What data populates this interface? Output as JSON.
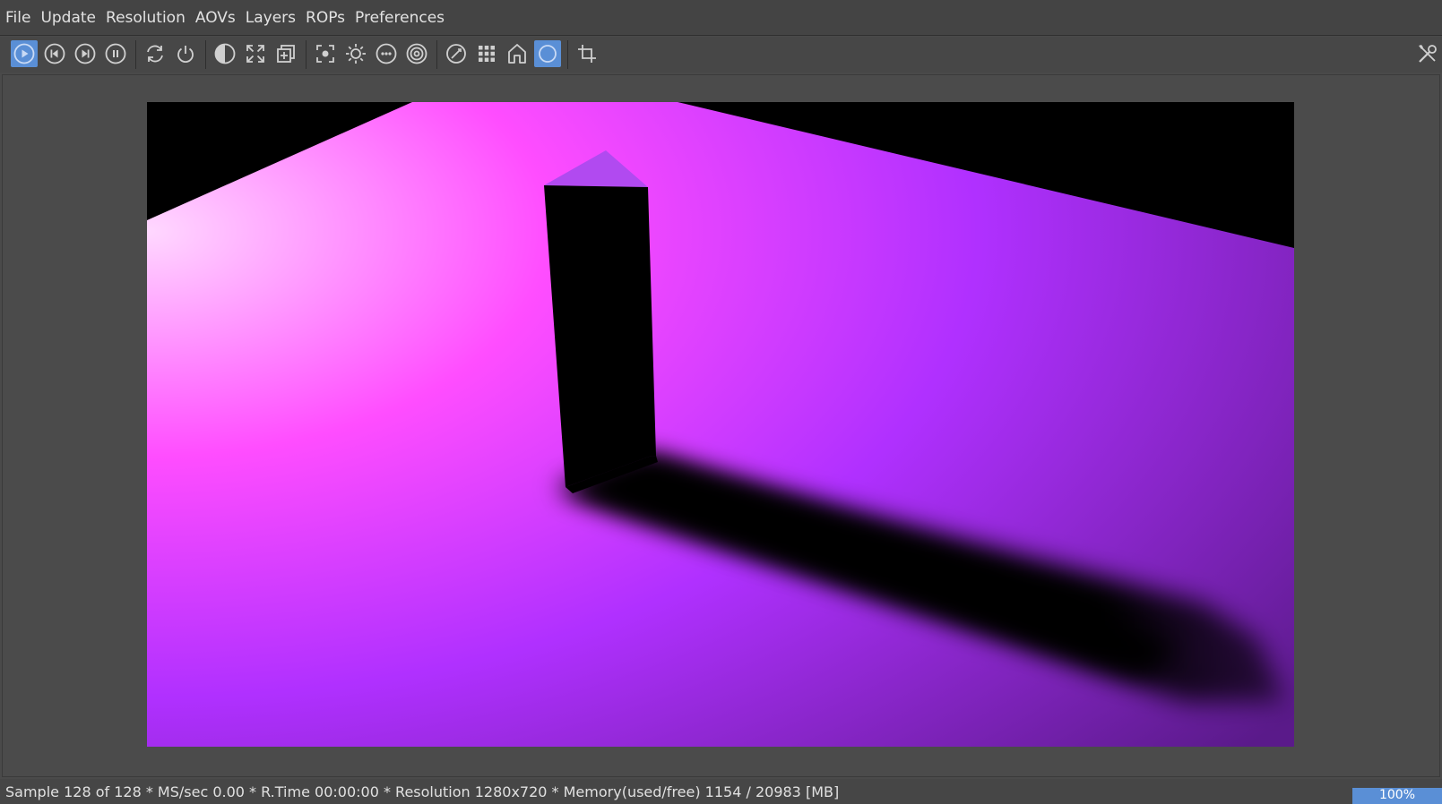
{
  "menu": {
    "items": [
      "File",
      "Update",
      "Resolution",
      "AOVs",
      "Layers",
      "ROPs",
      "Preferences"
    ]
  },
  "toolbar": {
    "buttons": [
      {
        "icon": "play-icon",
        "active": true
      },
      {
        "icon": "skip-back-icon",
        "active": false
      },
      {
        "icon": "skip-forward-icon",
        "active": false
      },
      {
        "icon": "pause-icon",
        "active": false
      },
      {
        "icon": "refresh-icon",
        "active": false
      },
      {
        "icon": "power-icon",
        "active": false
      },
      {
        "icon": "contrast-icon",
        "active": false
      },
      {
        "icon": "expand-icon",
        "active": false
      },
      {
        "icon": "copy-add-icon",
        "active": false
      },
      {
        "icon": "focus-icon",
        "active": false
      },
      {
        "icon": "sun-icon",
        "active": false
      },
      {
        "icon": "more-circle-icon",
        "active": false
      },
      {
        "icon": "target-icon",
        "active": false
      },
      {
        "icon": "compass-icon",
        "active": false
      },
      {
        "icon": "grid-icon",
        "active": false
      },
      {
        "icon": "home-icon",
        "active": false
      },
      {
        "icon": "region-icon",
        "active": true
      },
      {
        "icon": "crop-icon",
        "active": false
      },
      {
        "icon": "tools-icon",
        "active": false
      }
    ],
    "accent_color": "#5a8fd6"
  },
  "render": {
    "floor_colors": [
      "#ffd2ff",
      "#ff4dff",
      "#b030ff",
      "#5a1a8a"
    ],
    "background_color": "#000000"
  },
  "status": {
    "text": "Sample 128 of 128 * MS/sec 0.00 * R.Time 00:00:00 * Resolution 1280x720 * Memory(used/free) 1154 / 20983 [MB]",
    "zoom_label": "100%",
    "progress": 1.0
  }
}
